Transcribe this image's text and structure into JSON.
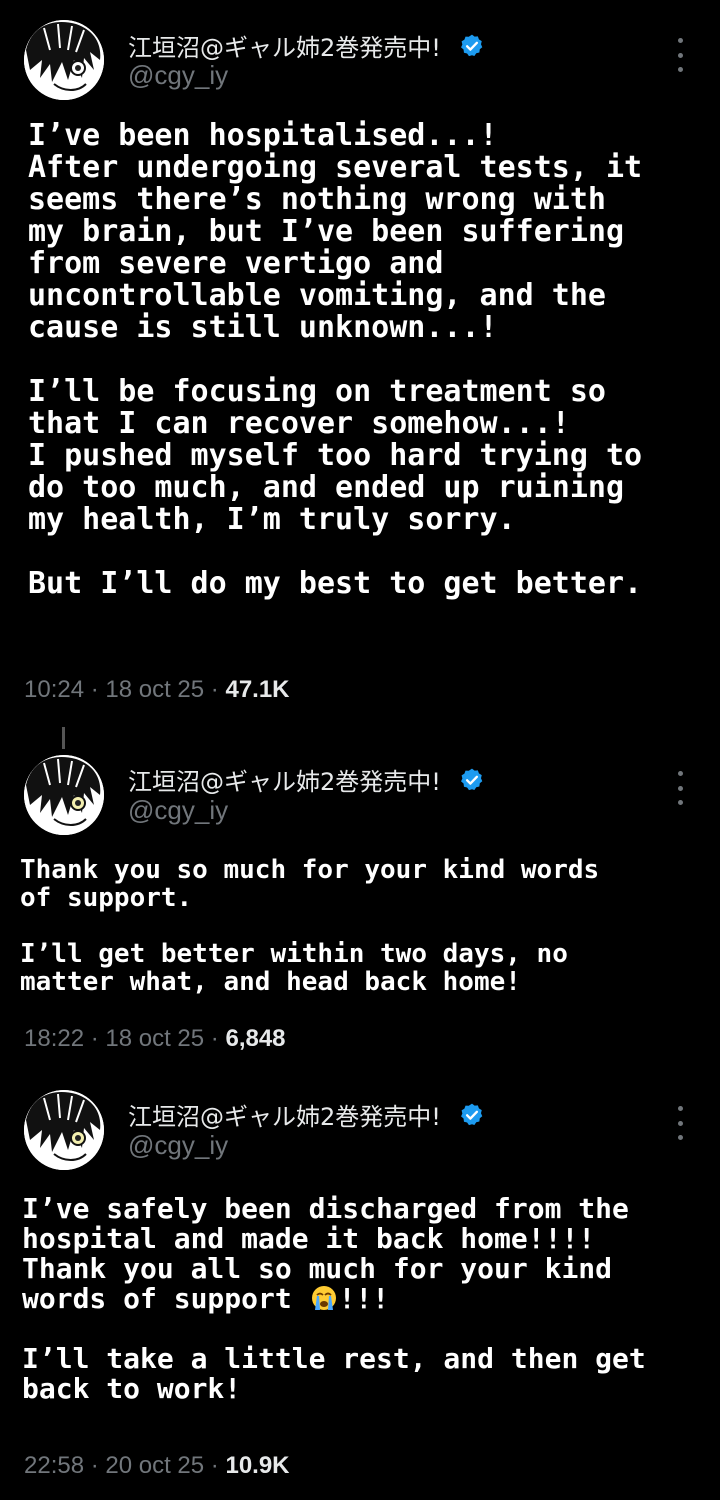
{
  "user": {
    "display_name": "江垣沼@ギャル姉2巻発売中!",
    "handle": "@cgy_iy"
  },
  "posts": [
    {
      "text": "I’ve been hospitalised...!\nAfter undergoing several tests, it\nseems there’s nothing wrong with\nmy brain, but I’ve been suffering\nfrom severe vertigo and\nuncontrollable vomiting, and the\ncause is still unknown...!\n\nI’ll be focusing on treatment so\nthat I can recover somehow...!\nI pushed myself too hard trying to\ndo too much, and ended up ruining\nmy health, I’m truly sorry.\n\nBut I’ll do my best to get better.",
      "time": "10:24 · 18 oct 25 · ",
      "views": "47.1K"
    },
    {
      "text": "Thank you so much for your kind words\nof support.\n\nI’ll get better within two days, no\nmatter what, and head back home!",
      "time": "18:22 · 18 oct 25 · ",
      "views": "6,848"
    },
    {
      "text_before_emoji": "I’ve safely been discharged from the\nhospital and made it back home!!!!\nThank you all so much for your kind\nwords of support ",
      "emoji": "loudly-crying-face-emoji",
      "text_after_emoji": "!!!\n\nI’ll take a little rest, and then get\nback to work!",
      "time": "22:58 · 20 oct 25 · ",
      "views": "10.9K"
    }
  ],
  "colors": {
    "background": "#000000",
    "secondary_text": "#71767b",
    "verified_blue": "#1d9bf0"
  },
  "icons": {
    "verified": "verified-badge-icon",
    "more": "more-options-icon"
  }
}
